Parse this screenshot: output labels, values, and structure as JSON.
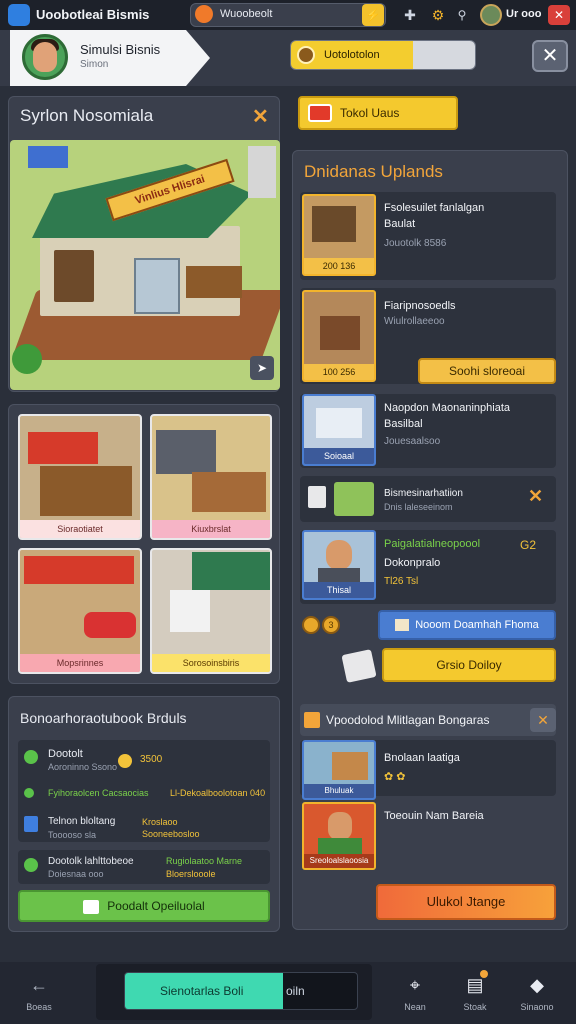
{
  "topbar": {
    "app_title": "Uoobotleai Bismis",
    "search_text": "Wuoobeolt",
    "label": "Ur ooo",
    "icons": [
      "app-logo-icon",
      "flame-icon",
      "lightning-icon",
      "puzzle-icon",
      "gear-icon",
      "search-icon",
      "close-icon"
    ]
  },
  "header": {
    "profile_name": "Simulsi Bisnis",
    "profile_sub": "Simon",
    "progress_label": "Uotolotolon",
    "progress_fraction": 0.66
  },
  "store_panel": {
    "title": "Syrlon Nosomiala",
    "sign": "Vinlius Hlisrai",
    "thumbnails": [
      {
        "caption": "Sioraotiatet"
      },
      {
        "caption": "Kiuxbrslat"
      },
      {
        "caption": "Mopsrinnes"
      },
      {
        "caption": "Sorosoinsbiris"
      }
    ]
  },
  "stock_panel": {
    "title": "Bonoarhoraotubook Brduls",
    "rows": [
      {
        "title": "Dootolt",
        "sub": "Aoroninno Ssono",
        "value": "3500"
      },
      {
        "title": "Fyihoraolcen Cacsaocias",
        "value": "Ll-Dekoalboolotoan 040"
      },
      {
        "title": "Telnon bloltang",
        "sub": "Tooooso sla",
        "value": "Kroslaoo Sooneebosloo"
      },
      {
        "title": "Dootolk lahlttobeoe",
        "sub": "Doiesnaa ooo",
        "value": "Rugiolaatoo Marne",
        "value2": "Bloerslooole"
      }
    ],
    "action_button": "Poodalt Opeiluolal"
  },
  "tab": {
    "label": "Tokol Uaus"
  },
  "upgrades_panel": {
    "title": "Dnidanas Uplands",
    "items": [
      {
        "title": "Fsolesuilet fanlalgan",
        "title2": "Baulat",
        "stat": "Jouotolk 8586",
        "label": "200  136"
      },
      {
        "title": "Fiaripnosoedls",
        "stat": "Wiulrollaeeoo",
        "label": "100  256",
        "button": "Soohi sloreoai"
      },
      {
        "title": "Naopdon Maonaninphiata",
        "title2": "Basilbal",
        "stat": "Jouesaalsoo",
        "label": "Soioaal"
      }
    ],
    "info_row": {
      "title": "Bismesinarhatiion",
      "sub": "Dnis laleseeinom"
    },
    "person": {
      "title": "Paigalatialneopoool",
      "title2": "Dokonpralo",
      "stat": "Tl26 Tsl",
      "level": "G2",
      "label": "Thisal"
    },
    "blue_button": "Nooom Doamhah Fhoma",
    "yellow_button": "Grsio Doiloy",
    "coin_count": "3"
  },
  "lower_panel": {
    "title": "Vpoodolod  Mlitlagan Bongaras",
    "items": [
      {
        "title": "Bnolaan laatiga",
        "stat": "Bhuluak"
      },
      {
        "title": "Toeouin Nam Bareia",
        "label": "Sreoloalslaoosia"
      }
    ],
    "action_button": "Ulukol Jtange"
  },
  "bottombar": {
    "back_label": "Boeas",
    "center_label": "Sienotarlas Boli",
    "center_right": "oiln",
    "nav": [
      {
        "label": "Nean",
        "icon": "location-pin-icon"
      },
      {
        "label": "Stoak",
        "icon": "chart-icon"
      },
      {
        "label": "Sinaono",
        "icon": "diamond-icon"
      }
    ],
    "progress_fraction": 0.68
  },
  "colors": {
    "background": "#2a2f3a",
    "panel": "#3a3f4c",
    "accent_yellow": "#f4c92e",
    "accent_green": "#6bc24a",
    "accent_orange": "#f2a53a",
    "accent_teal": "#3fd9b1"
  }
}
